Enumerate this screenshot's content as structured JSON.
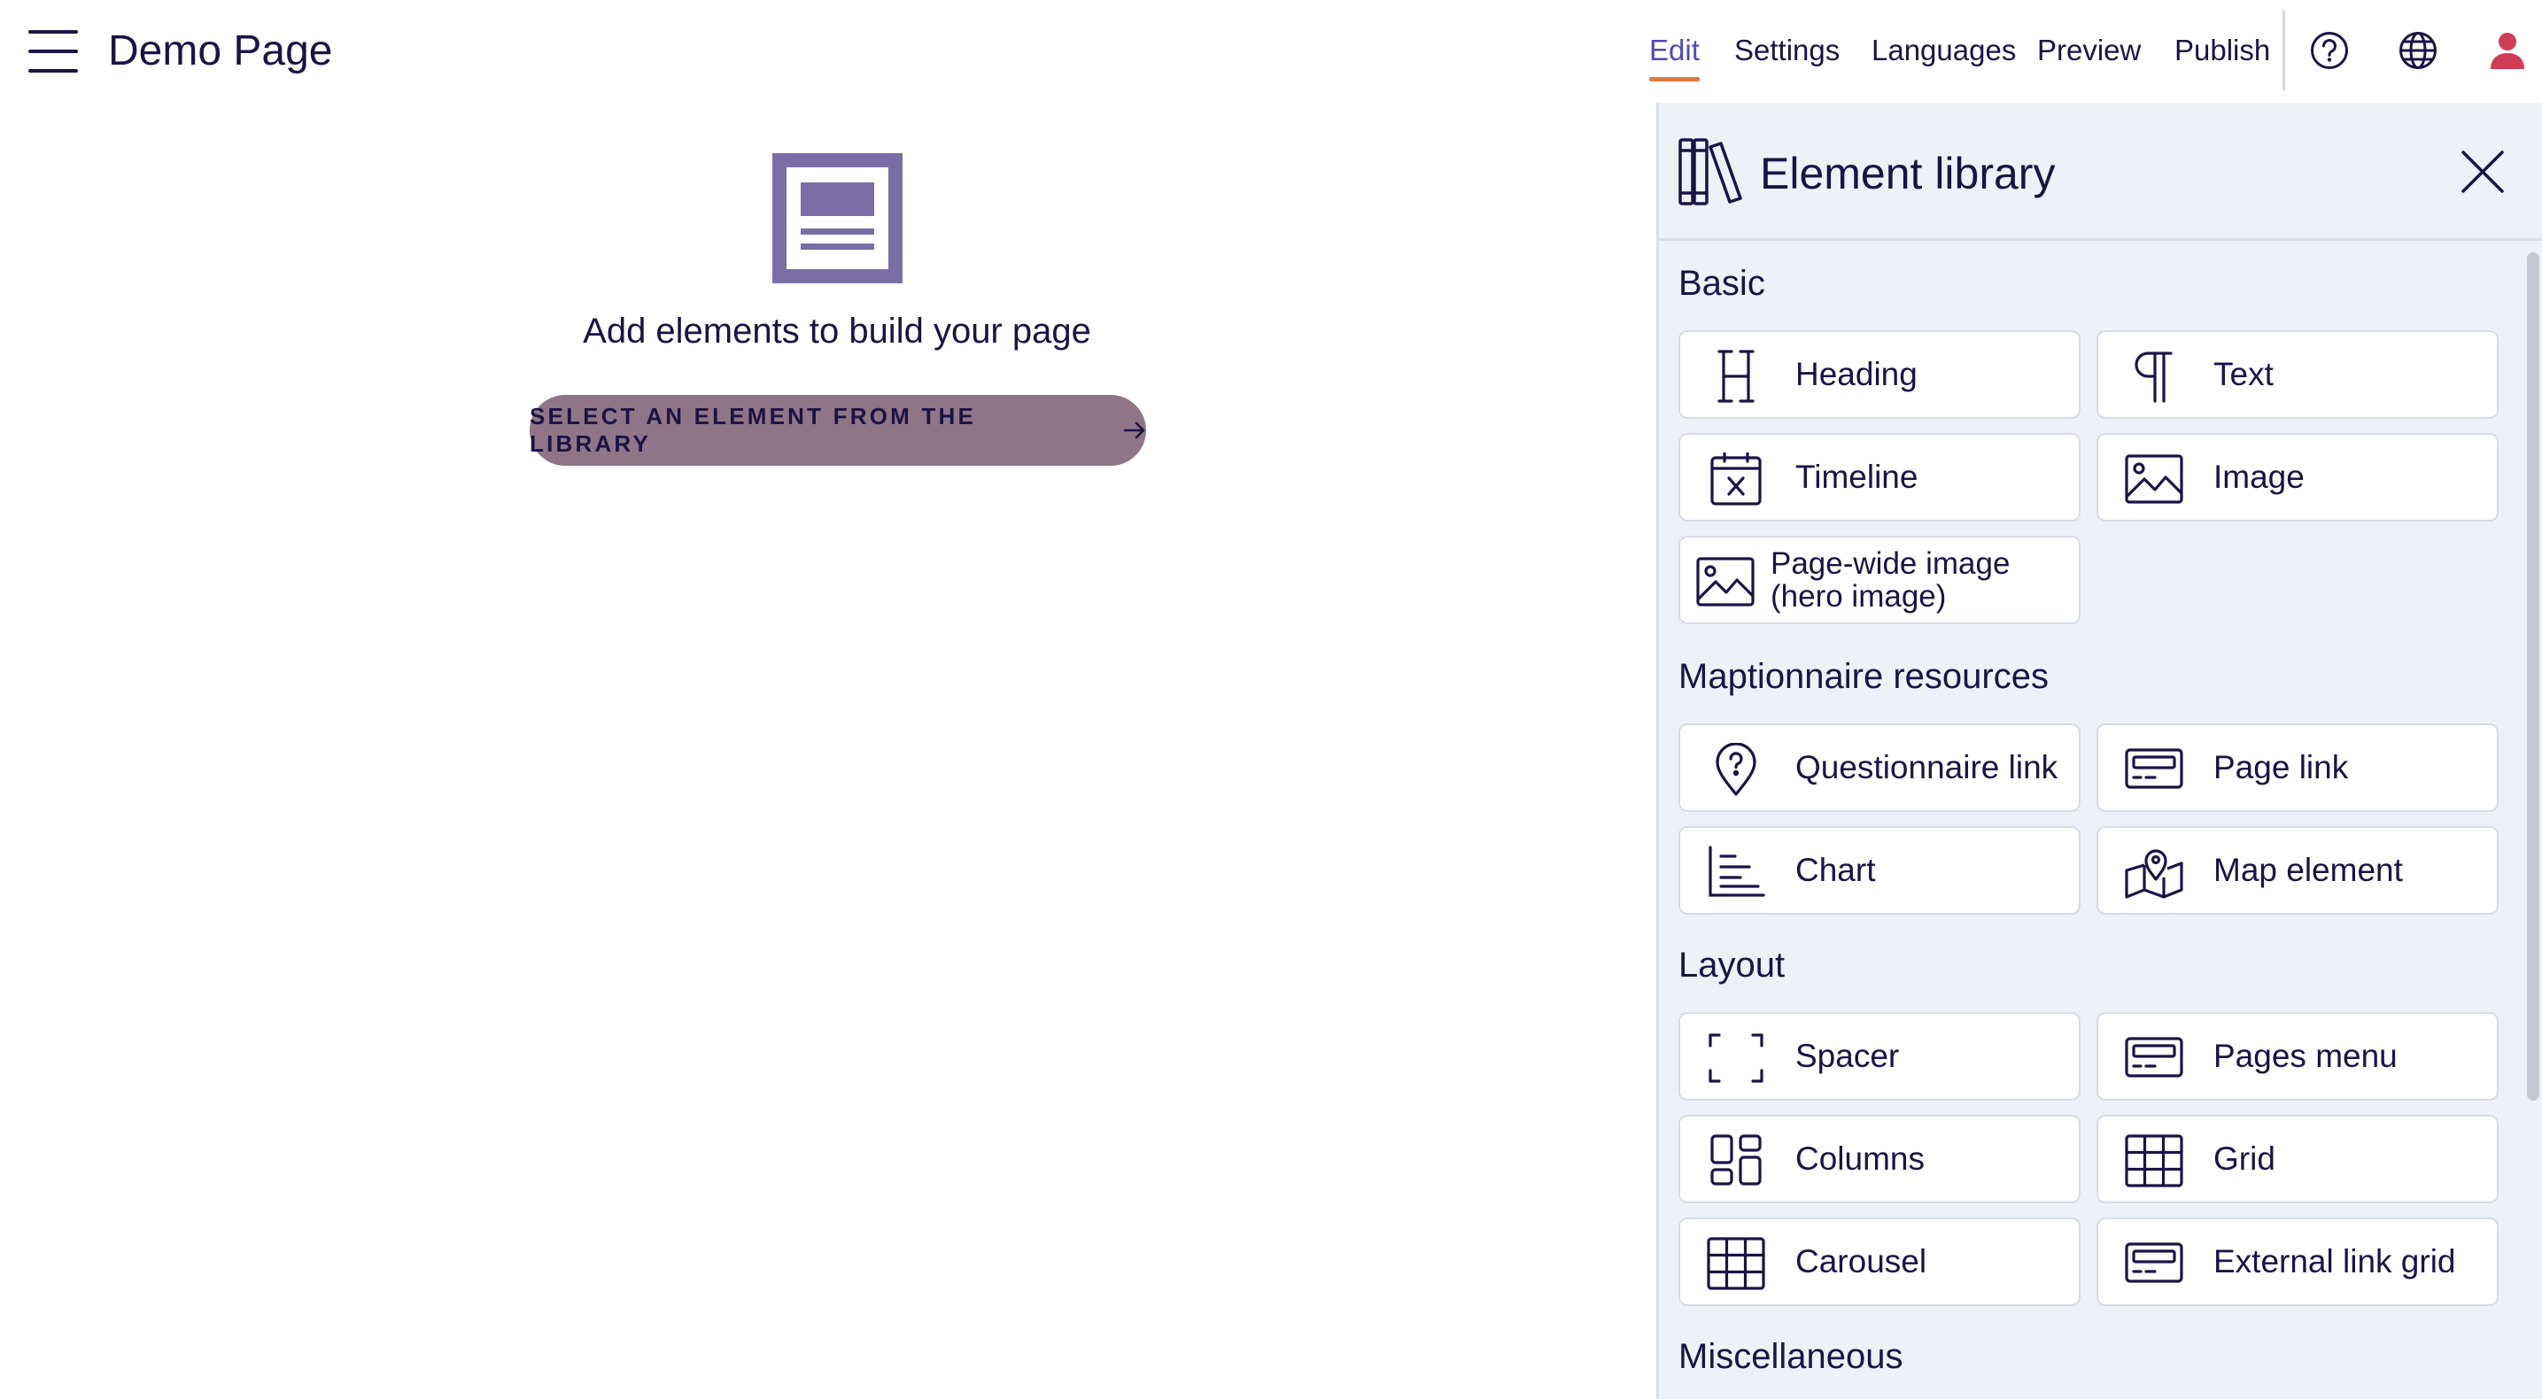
{
  "header": {
    "page_title": "Demo Page",
    "nav": [
      {
        "label": "Edit",
        "active": true
      },
      {
        "label": "Settings",
        "active": false
      },
      {
        "label": "Languages",
        "active": false
      },
      {
        "label": "Preview",
        "active": false
      },
      {
        "label": "Publish",
        "active": false
      }
    ],
    "icons": [
      "help-icon",
      "globe-icon",
      "user-icon"
    ],
    "accent_color": "#4d4ab5",
    "active_underline_color": "#e07845",
    "user_icon_color": "#d23d56"
  },
  "main": {
    "empty_state_icon": "page-layout-icon",
    "empty_state_text": "Add elements to build your page",
    "cta_label": "SELECT AN ELEMENT FROM THE LIBRARY",
    "cta_icon": "arrow-right-icon",
    "cta_color": "#8f7586",
    "illustration_color": "#7b6ea6"
  },
  "panel": {
    "title": "Element library",
    "title_icon": "library-books-icon",
    "close_icon": "close-icon",
    "sections": [
      {
        "title": "Basic",
        "items": [
          {
            "label": "Heading",
            "icon": "heading-icon"
          },
          {
            "label": "Text",
            "icon": "paragraph-icon"
          },
          {
            "label": "Timeline",
            "icon": "calendar-x-icon"
          },
          {
            "label": "Image",
            "icon": "image-icon"
          },
          {
            "label": "Page-wide image (hero image)",
            "line1": "Page-wide image",
            "line2": "(hero image)",
            "icon": "hero-image-icon"
          }
        ]
      },
      {
        "title": "Maptionnaire resources",
        "items": [
          {
            "label": "Questionnaire link",
            "icon": "questionnaire-pin-icon"
          },
          {
            "label": "Page link",
            "icon": "page-link-icon"
          },
          {
            "label": "Chart",
            "icon": "chart-icon"
          },
          {
            "label": "Map element",
            "icon": "map-pin-icon"
          }
        ]
      },
      {
        "title": "Layout",
        "items": [
          {
            "label": "Spacer",
            "icon": "spacer-icon"
          },
          {
            "label": "Pages menu",
            "icon": "pages-menu-icon"
          },
          {
            "label": "Columns",
            "icon": "columns-icon"
          },
          {
            "label": "Grid",
            "icon": "grid-icon"
          },
          {
            "label": "Carousel",
            "icon": "carousel-icon"
          },
          {
            "label": "External link grid",
            "icon": "external-link-grid-icon"
          }
        ]
      },
      {
        "title": "Miscellaneous",
        "items": []
      }
    ]
  }
}
